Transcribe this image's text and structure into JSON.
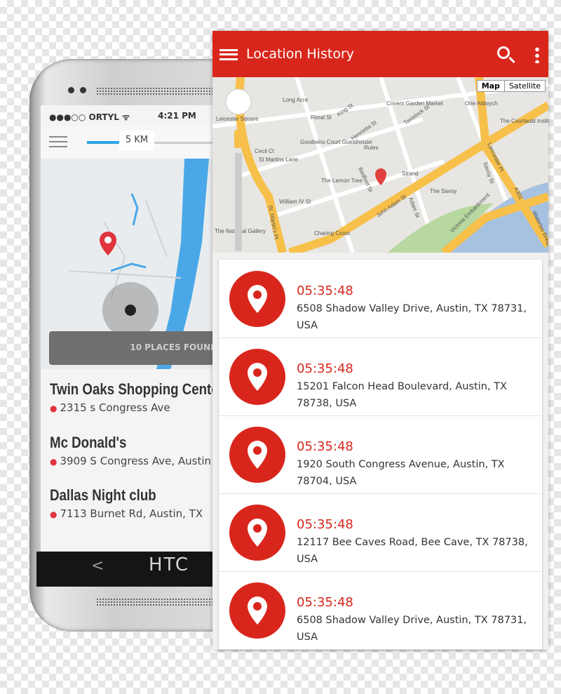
{
  "phone": {
    "brand": "HTC",
    "back": "<",
    "status": {
      "carrier": "●●●○○ ORTYL ᯤ",
      "time": "4:21 PM"
    },
    "radius": "5 KM",
    "found": "10 PLACES FOUND",
    "places": [
      {
        "name": "Twin Oaks Shopping Center",
        "address": "2315 s Congress Ave"
      },
      {
        "name": "Mc Donald's",
        "address": "3909 S Congress Ave, Austin"
      },
      {
        "name": "Dallas Night club",
        "address": "7113 Burnet Rd, Austin, TX"
      }
    ]
  },
  "app": {
    "title": "Location History",
    "icons": [
      "menu-icon",
      "search-icon",
      "more-vert-icon"
    ],
    "map": {
      "type_buttons": [
        "Map",
        "Satellite"
      ],
      "labels": [
        "Long Acre",
        "Floral St",
        "Covent Garden Market",
        "King St",
        "Leicester Square",
        "Goodwins Court Guesthouse",
        "Henrietta St",
        "Rules",
        "Tavistock St",
        "One Aldwych",
        "The Courtauld Institute of Art",
        "Cecil Ct",
        "St Martins Lane",
        "Bedford St",
        "The Lemon Tree",
        "Strand",
        "A4",
        "Lancaster Pl",
        "Savoy St",
        "The Savoy",
        "William IV St",
        "St. Martin's Pl",
        "Adam St",
        "John Adam St",
        "Victoria Embankment",
        "A301",
        "Waterloo Bridge",
        "Charing Cross",
        "The National Gallery"
      ]
    },
    "history": [
      {
        "time": "05:35:48",
        "address": "6508 Shadow Valley Drive, Austin, TX 78731, USA"
      },
      {
        "time": "05:35:48",
        "address": "15201 Falcon Head Boulevard, Austin, TX 78738, USA"
      },
      {
        "time": "05:35:48",
        "address": "1920 South Congress Avenue, Austin, TX 78704, USA"
      },
      {
        "time": "05:35:48",
        "address": "12117 Bee Caves Road, Bee Cave, TX 78738, USA"
      },
      {
        "time": "05:35:48",
        "address": "6508 Shadow Valley Drive, Austin, TX 78731, USA"
      }
    ]
  },
  "colors": {
    "accent": "#d9261c",
    "slider": "#2ba3e6",
    "road": "#f7c04a"
  }
}
